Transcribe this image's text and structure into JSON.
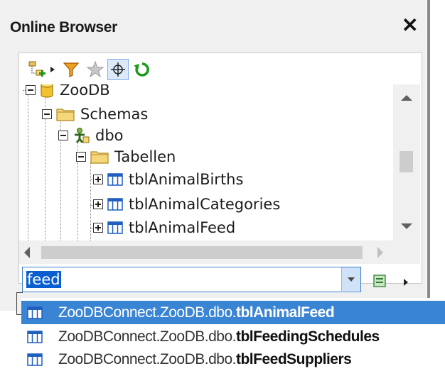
{
  "panel": {
    "title": "Online Browser",
    "close_icon": "close-icon"
  },
  "toolbar": {
    "icons": [
      "add-connection-icon",
      "filter-icon",
      "favorite-star-icon",
      "locate-crosshair-icon",
      "refresh-icon"
    ]
  },
  "tree": {
    "database": "ZooDB",
    "schemas": "Schemas",
    "schema": "dbo",
    "tables_folder": "Tabellen",
    "tables": [
      "tblAnimalBirths",
      "tblAnimalCategories",
      "tblAnimalFeed"
    ]
  },
  "search": {
    "value": "feed"
  },
  "suggestions": [
    {
      "prefix": "ZooDBConnect.ZooDB.dbo.",
      "name": "tblAnimalFeed",
      "selected": true
    },
    {
      "prefix": "ZooDBConnect.ZooDB.dbo.",
      "name": "tblFeedingSchedules",
      "selected": false
    },
    {
      "prefix": "ZooDBConnect.ZooDB.dbo.",
      "name": "tblFeedSuppliers",
      "selected": false
    }
  ],
  "colors": {
    "selection": "#3a84d4",
    "folder": "#f5d67a",
    "table_icon": "#1f5fbf",
    "refresh": "#1a9a1a",
    "filter": "#e08a00"
  }
}
